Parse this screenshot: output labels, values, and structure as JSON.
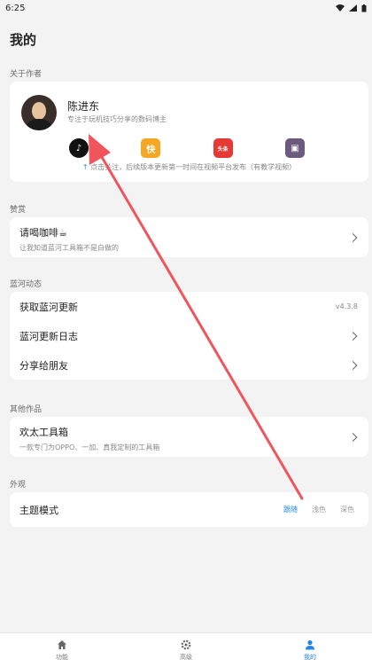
{
  "status": {
    "time": "6:25"
  },
  "page_title": "我的",
  "sections": {
    "about": "关于作者",
    "reward": "赞赏",
    "updates": "蓝河动态",
    "other": "其他作品",
    "appearance": "外观"
  },
  "author": {
    "name": "陈进东",
    "desc": "专注于玩机技巧分享的数码博主",
    "platforms": [
      {
        "name": "douyin-icon",
        "glyph": "♪"
      },
      {
        "name": "kuaishou-icon",
        "glyph": "快"
      },
      {
        "name": "toutiao-icon",
        "glyph": "头条"
      },
      {
        "name": "bilibili-icon",
        "glyph": "▣"
      }
    ],
    "follow_tip": "点击关注，后续版本更新第一时间在视频平台发布（有教学视频）"
  },
  "reward": {
    "title": "请喝咖啡☕",
    "subtitle": "让我知道蓝河工具箱不是白做的"
  },
  "updates": {
    "get_update": "获取蓝河更新",
    "version": "v4.3.8",
    "changelog": "蓝河更新日志",
    "share": "分享给朋友"
  },
  "other": {
    "title": "欢太工具箱",
    "subtitle": "一款专门为OPPO、一加、真我定制的工具箱"
  },
  "appearance": {
    "theme_label": "主题模式",
    "options": [
      "跟随",
      "浅色",
      "深色"
    ],
    "selected": "跟随"
  },
  "nav": {
    "items": [
      {
        "label": "功能"
      },
      {
        "label": "高级"
      },
      {
        "label": "我的"
      }
    ],
    "active": "我的"
  },
  "colors": {
    "accent": "#1e88e5",
    "annotation_arrow": "#f0545c"
  }
}
